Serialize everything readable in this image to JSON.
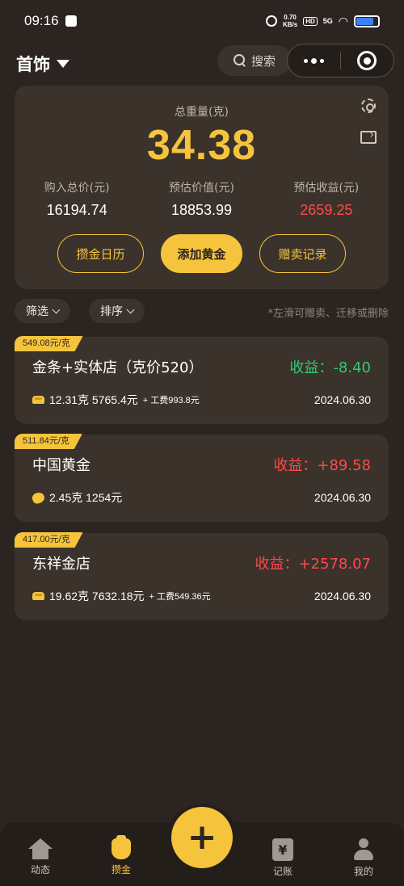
{
  "status_bar": {
    "time": "09:16",
    "net_speed_value": "0.70",
    "net_speed_unit": "KB/s",
    "hd": "HD",
    "signal": "5G",
    "wifi_icon": "wifi-icon",
    "battery_level": 0.8,
    "battery_color": "#3b82f6"
  },
  "nav": {
    "title": "首饰",
    "search_label": "搜索"
  },
  "summary": {
    "total_weight_label": "总重量(克)",
    "total_weight_value": "34.38",
    "stats": [
      {
        "label": "购入总价(元)",
        "value": "16194.74"
      },
      {
        "label": "预估价值(元)",
        "value": "18853.99"
      },
      {
        "label": "预估收益(元)",
        "value": "2659.25"
      }
    ],
    "actions": {
      "calendar": "攒金日历",
      "add_gold": "添加黄金",
      "gift_sell": "赠卖记录"
    }
  },
  "filters": {
    "filter_label": "筛选",
    "sort_label": "排序",
    "hint": "*左滑可赠卖、迁移或删除"
  },
  "items": [
    {
      "price_tag": "549.08元/克",
      "name": "金条+实体店（克价520）",
      "profit": "收益：-8.40",
      "icon": "gold-bar-icon",
      "detail": "12.31克 5765.4元",
      "fee": "+ 工费993.8元",
      "date": "2024.06.30"
    },
    {
      "price_tag": "511.84元/克",
      "name": "中国黄金",
      "profit": "收益：+89.58",
      "icon": "gold-bean-icon",
      "detail": "2.45克 1254元",
      "fee": "",
      "date": "2024.06.30"
    },
    {
      "price_tag": "417.00元/克",
      "name": "东祥金店",
      "profit": "收益：+2578.07",
      "icon": "gold-bar-icon",
      "detail": "19.62克 7632.18元",
      "fee": "+ 工费549.36元",
      "date": "2024.06.30"
    }
  ],
  "tabbar": {
    "tabs": [
      {
        "label": "动态",
        "icon": "home-icon"
      },
      {
        "label": "攒金",
        "icon": "gold-bag-icon"
      },
      {
        "label": "记账",
        "icon": "ledger-icon"
      },
      {
        "label": "我的",
        "icon": "user-icon"
      }
    ],
    "fab": "+",
    "ledger_glyph": "¥"
  },
  "colors": {
    "background": "#2b2420",
    "card": "#3a322b",
    "accent_gold": "#f5c43c",
    "profit_red": "#ff4a4a",
    "loss_green": "#2ecc71"
  }
}
